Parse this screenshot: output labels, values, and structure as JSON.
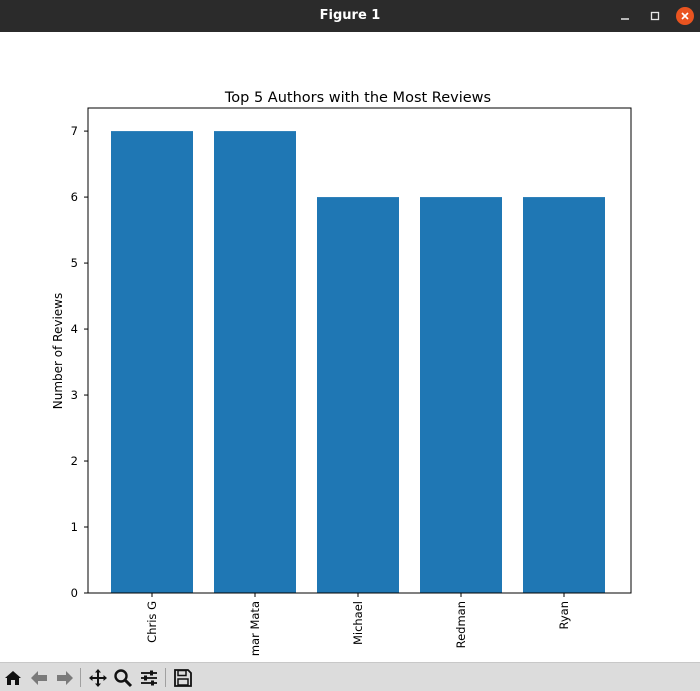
{
  "window": {
    "title": "Figure 1"
  },
  "chart_data": {
    "type": "bar",
    "title": "Top 5 Authors with the Most Reviews",
    "xlabel": "",
    "ylabel": "Number of Reviews",
    "categories": [
      "Chris G",
      "mar Mata",
      "Michael",
      "Redman",
      "Ryan"
    ],
    "values": [
      7,
      7,
      6,
      6,
      6
    ],
    "ylim": [
      0,
      7.35
    ],
    "yticks": [
      "0",
      "1",
      "2",
      "3",
      "4",
      "5",
      "6",
      "7"
    ],
    "grid": false,
    "bar_color": "#1f77b4"
  },
  "toolbar": {
    "items": [
      "home-icon",
      "back-icon",
      "forward-icon",
      "pan-icon",
      "zoom-icon",
      "configure-icon",
      "save-icon"
    ]
  }
}
